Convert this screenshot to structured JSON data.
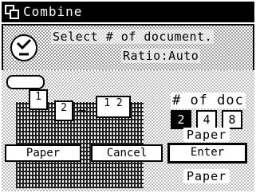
{
  "window": {
    "title": "Combine",
    "icon": "combine-icon"
  },
  "message": {
    "line1": "Select # of document.",
    "line2": "Ratio:Auto",
    "icon": "info-icon"
  },
  "device": {
    "icon": "device-icon"
  },
  "preview": {
    "page1_label": "1",
    "page2_label": "2",
    "page_combined_label": "1 2",
    "arrow": "→"
  },
  "num_of_doc": {
    "label": "# of doc",
    "options": [
      "2",
      "4",
      "8"
    ],
    "selected": "2"
  },
  "paper_labels": {
    "upper": "Paper",
    "lower": "Paper"
  },
  "softkeys": {
    "paper": "Paper",
    "cancel": "Cancel",
    "enter": "Enter"
  },
  "colors": {
    "lcd_fg": "#000000",
    "lcd_bg": "#ffffff"
  }
}
